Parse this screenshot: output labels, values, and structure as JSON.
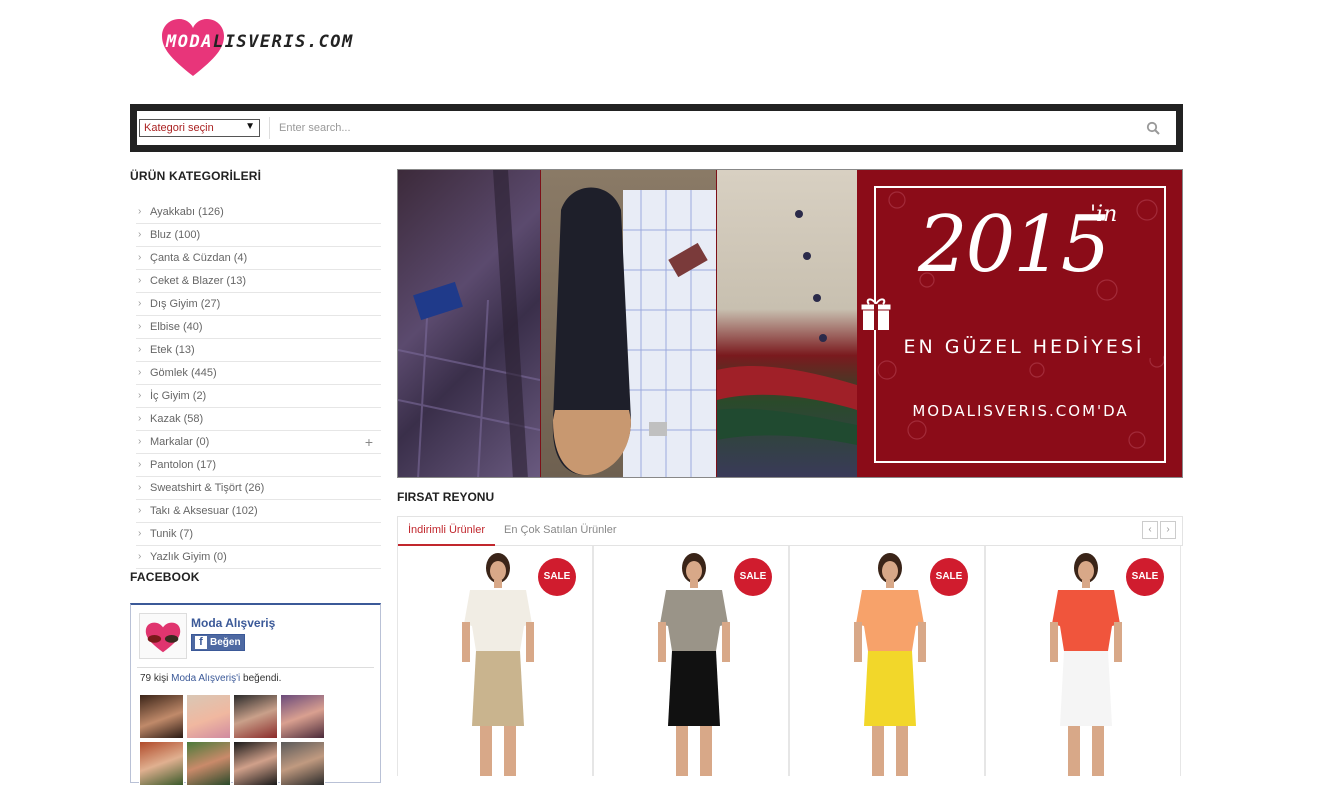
{
  "brand": {
    "logo_text_pink": "MODA",
    "logo_text_dark": "LISVERIS.COM"
  },
  "search": {
    "category_label": "Kategori seçin",
    "placeholder": "Enter search..."
  },
  "sidebar": {
    "categories_title": "ÜRÜN KATEGORİLERİ",
    "items": [
      {
        "label": "Ayakkabı (126)"
      },
      {
        "label": "Bluz (100)"
      },
      {
        "label": "Çanta & Cüzdan (4)"
      },
      {
        "label": "Ceket & Blazer (13)"
      },
      {
        "label": "Dış Giyim (27)"
      },
      {
        "label": "Elbise (40)"
      },
      {
        "label": "Etek (13)"
      },
      {
        "label": "Gömlek (445)"
      },
      {
        "label": "İç Giyim (2)"
      },
      {
        "label": "Kazak (58)"
      },
      {
        "label": "Markalar (0)",
        "expand": "+"
      },
      {
        "label": "Pantolon (17)"
      },
      {
        "label": "Sweatshirt & Tişört (26)"
      },
      {
        "label": "Takı & Aksesuar (102)"
      },
      {
        "label": "Tunik (7)"
      },
      {
        "label": "Yazlık Giyim (0)"
      }
    ],
    "facebook_title": "FACEBOOK"
  },
  "facebook": {
    "page_name": "Moda Alışveriş",
    "like_label": "Beğen",
    "count_prefix": "79 kişi ",
    "count_link": "Moda Alışveriş'i",
    "count_suffix": " beğendi."
  },
  "banner": {
    "year": "2015",
    "suffix": "'in",
    "line1": "EN GÜZEL HEDİYESİ",
    "line2": "MODALISVERIS.COM'DA"
  },
  "deals": {
    "title": "FIRSAT REYONU",
    "tabs": [
      "İndirimli Ürünler",
      "En Çok Satılan Ürünler"
    ],
    "prev_label": "‹",
    "next_label": "›",
    "products": [
      {
        "badge": "SALE",
        "top_color": "#f1ede4",
        "bottom_color": "#c9b48e"
      },
      {
        "badge": "SALE",
        "top_color": "#9a9488",
        "bottom_color": "#111111"
      },
      {
        "badge": "SALE",
        "top_color": "#f7a26a",
        "bottom_color": "#f2d72a"
      },
      {
        "badge": "SALE",
        "top_color": "#f0553c",
        "bottom_color": "#f5f5f5"
      }
    ]
  },
  "colors": {
    "accent": "#c1272d",
    "dark_bar": "#222222",
    "facebook": "#3b5998"
  }
}
